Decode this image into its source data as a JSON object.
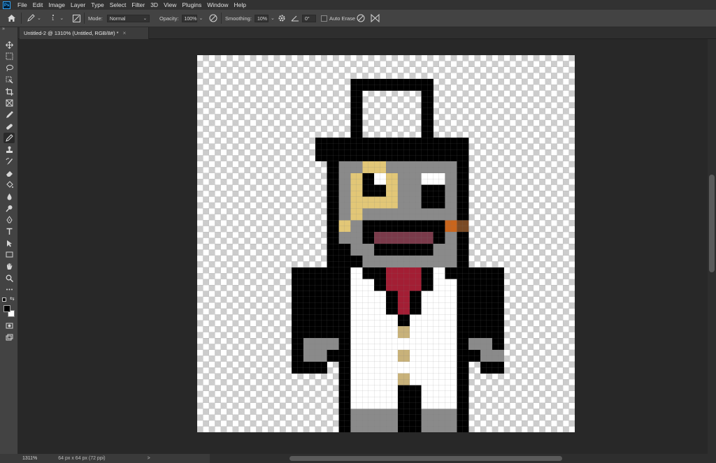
{
  "app": {
    "logo_text": "Ps"
  },
  "menu": [
    "File",
    "Edit",
    "Image",
    "Layer",
    "Type",
    "Select",
    "Filter",
    "3D",
    "View",
    "Plugins",
    "Window",
    "Help"
  ],
  "options": {
    "brush_size": "1",
    "mode_label": "Mode:",
    "mode_value": "Normal",
    "opacity_label": "Opacity:",
    "opacity_value": "100%",
    "smoothing_label": "Smoothing:",
    "smoothing_value": "10%",
    "angle_value": "0°",
    "auto_erase_label": "Auto Erase"
  },
  "document": {
    "tab_label": "Untitled-2 @ 1310% (Untitled, RGB/8#) *",
    "close_glyph": "×"
  },
  "status": {
    "zoom": "1311%",
    "doc_size": "64 px x 64 px (72 ppi)",
    "arrow": ">"
  },
  "colors": {
    "foreground": "#000000",
    "background": "#ffffff",
    "accent": "#31a8ff"
  },
  "tools": [
    "move-icon",
    "marquee-icon",
    "lasso-icon",
    "object-select-icon",
    "crop-icon",
    "frame-icon",
    "eyedropper-icon",
    "healing-icon",
    "pencil-icon",
    "stamp-icon",
    "history-brush-icon",
    "eraser-icon",
    "paint-bucket-icon",
    "blur-icon",
    "dodge-icon",
    "pen-icon",
    "type-icon",
    "path-select-icon",
    "rectangle-icon",
    "hand-icon",
    "zoom-icon",
    "more-icon"
  ],
  "pixel_art": {
    "grid_size": 32,
    "palette": {
      "K": "#000000",
      "W": "#ffffff",
      "G": "#8a8a8a",
      "Y": "#e2c777",
      "R": "#a31e34",
      "P": "#7a3a4a",
      "O": "#c9651c",
      "B": "#7a4a24",
      "T": "#c8b27a"
    },
    "rows": [
      "................................",
      "................................",
      ".............KKKKKKK............",
      ".............K.....K............",
      ".............K.....K............",
      ".............K.....K............",
      ".............K.....K............",
      "..........KKKKKKKKKKKKK.........",
      "..........KKKKKKKKKKKKK.........",
      "...........KGGYYGGGGGGK.........",
      "...........KGYKWYGGWWGK.........",
      "...........KGYKKYGGKKGK.........",
      "...........KGYYYYGGKKGK.........",
      "...........KGYGGGGGGGGK.........",
      "...........KYGKKKKKKKOB.........",
      "...........KGGKPPPPPKGK.........",
      "...........KKGGKKKKKGGK.........",
      "...........KKKGGGGGGGGK.........",
      "........KKKKKWKKRRRKWKKKKK......",
      "........KKKKKWWKRRRKWWKKKK......",
      "........KKKKKWWWKRKWWWKKKK......",
      "........KKKKKWWWKRKWWWKKKK......",
      "........KKKKKWWWWKWWWWKKKK......",
      "........KKKKKWWWWTWWWWKKKK......",
      "........KGGGKWWWWWWWWWKGGK......",
      "........KGGKKWWWWTWWWWKKGG......",
      "........KKK.KWWWWWWWWWK.KK......",
      "............KWWWWTWWWWK.........",
      "............KWWWWKKWWWK.........",
      "............KWWWWKKWWWK.........",
      "............KGGGGKKGGGK.........",
      "............KGGGGKKGGGK........."
    ]
  }
}
